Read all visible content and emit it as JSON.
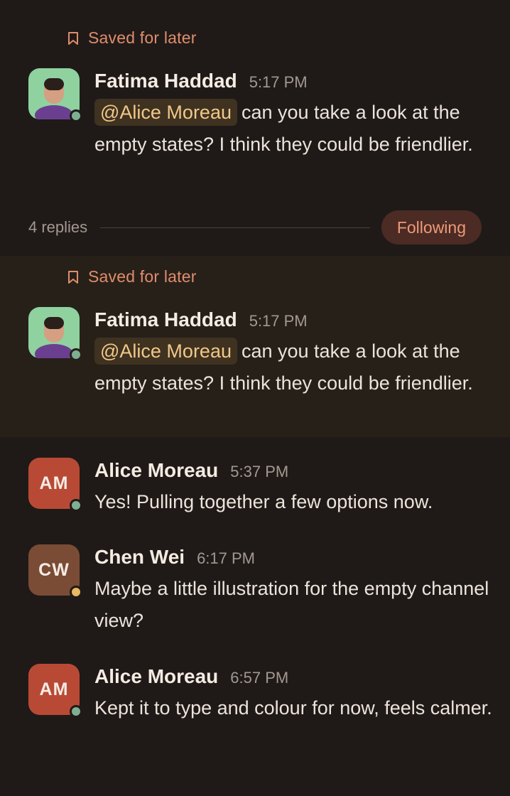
{
  "saved_label": "Saved for later",
  "colors": {
    "background": "#1f1a18",
    "highlight_background": "#272019",
    "accent": "#e08d6c",
    "mention_bg": "#3f3220",
    "mention_text": "#f1c88a",
    "presence_online": "#7faf93",
    "presence_away": "#e9b861"
  },
  "top_message": {
    "author": "Fatima Haddad",
    "time": "5:17 PM",
    "mention": "@Alice Moreau",
    "text": "can you take a look at the empty states? I think they could be friendlier.",
    "presence": "online"
  },
  "thread_footer": {
    "replies": "4 replies",
    "follow_label": "Following"
  },
  "highlight_message": {
    "author": "Fatima Haddad",
    "time": "5:17 PM",
    "mention": "@Alice Moreau",
    "text": "can you take a look at the empty states? I think they could be friendlier.",
    "presence": "online"
  },
  "replies": [
    {
      "initials": "AM",
      "author": "Alice Moreau",
      "time": "5:37 PM",
      "text": "Yes! Pulling together a few options now.",
      "avatar_color": "#b84a35",
      "presence": "online"
    },
    {
      "initials": "CW",
      "author": "Chen Wei",
      "time": "6:17 PM",
      "text": "Maybe a little illustration for the empty channel view?",
      "avatar_color": "#7a4c35",
      "presence": "away"
    },
    {
      "initials": "AM",
      "author": "Alice Moreau",
      "time": "6:57 PM",
      "text": "Kept it to type and colour for now, feels calmer.",
      "avatar_color": "#b84a35",
      "presence": "online"
    }
  ]
}
